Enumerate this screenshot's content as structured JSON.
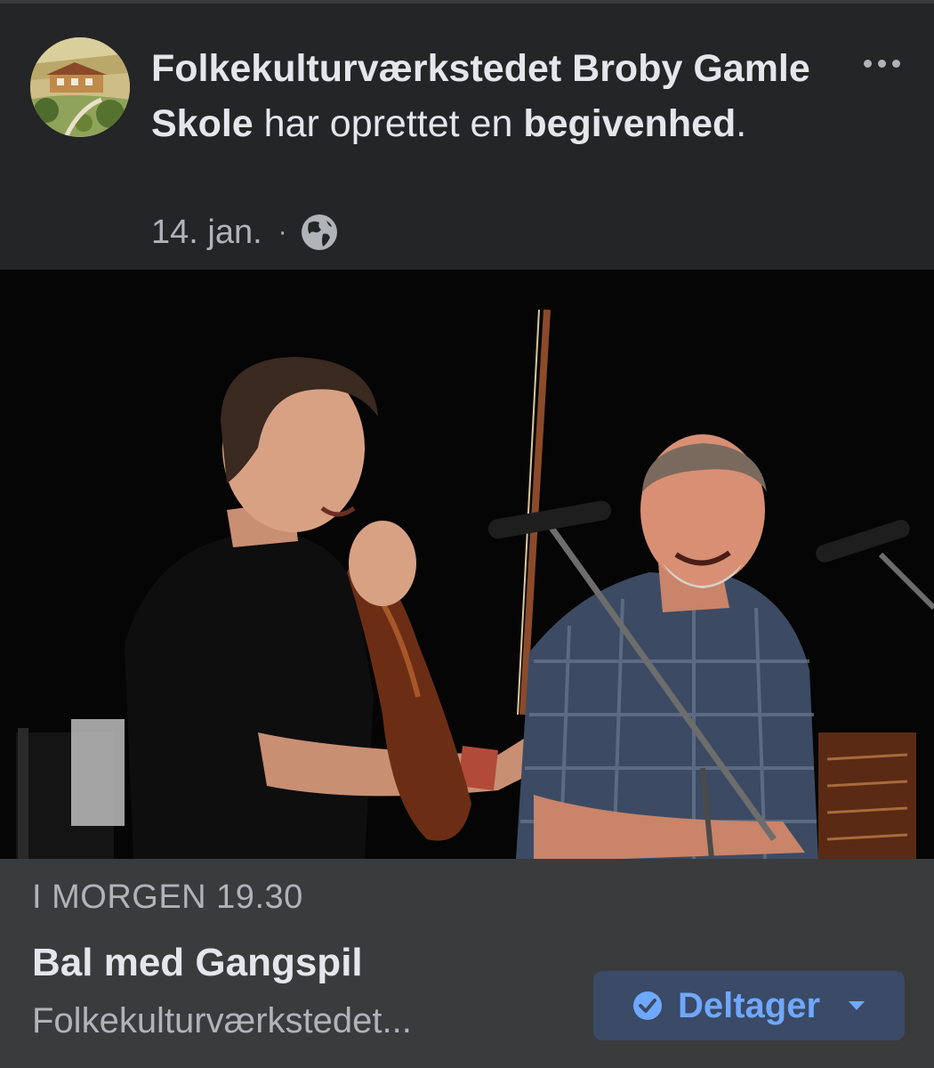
{
  "post": {
    "page_name": "Folkekulturværkstedet Broby Gamle Skole",
    "action_text": " har oprettet en ",
    "action_object": "begivenhed",
    "action_end": ".",
    "date": "14. jan.",
    "separator": "·",
    "privacy_icon": "globe-icon",
    "more_icon": "more-dots-icon"
  },
  "event": {
    "time": "I MORGEN 19.30",
    "title": "Bal med Gangspil",
    "host": "Folkekulturværkstedet...",
    "rsvp_label": "Deltager",
    "rsvp_icon": "check-circle-icon",
    "rsvp_dropdown_icon": "chevron-down-icon"
  },
  "colors": {
    "background": "#242526",
    "footer": "#3a3b3c",
    "primary_text": "#e4e6eb",
    "secondary_text": "#b0b3b8",
    "accent": "#6fa8ff",
    "button_bg": "#3b4a66"
  }
}
